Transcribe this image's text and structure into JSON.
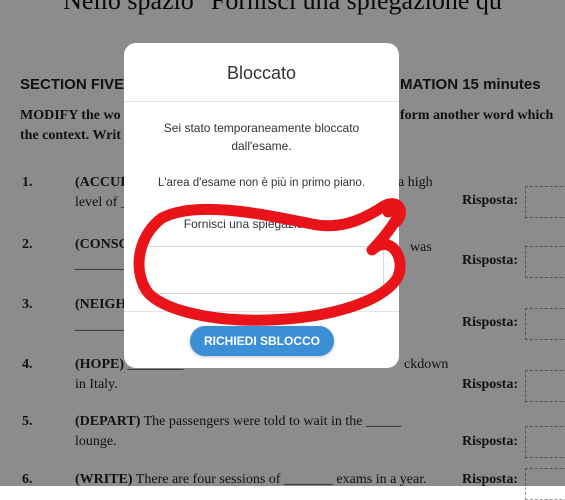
{
  "caption": "Nello spazio \"Fornisci una spiegazione qu",
  "exam": {
    "section_title_left": "SECTION FIVE C",
    "section_title_right": "MATION 15 minutes",
    "instructions_line1_left": "MODIFY the wo",
    "instructions_line1_right": "form another word which",
    "instructions_line2": "the context. Writ",
    "answer_label": "Risposta:",
    "questions": [
      {
        "num": "1.",
        "line1": "(ACCUI",
        "line2": "level of _",
        "right": "a high"
      },
      {
        "num": "2.",
        "line1": "(CONSC",
        "line2": "________",
        "right": "was"
      },
      {
        "num": "3.",
        "line1": "(NEIGH",
        "line2": "________",
        "right": ""
      },
      {
        "num": "4.",
        "line1_bold": "(HOPE)",
        "line1_rest": " ________",
        "line2": "in Italy.",
        "right": "ckdown"
      },
      {
        "num": "5.",
        "line1_bold": "(DEPART)",
        "line1_rest": " The passengers were told to wait in the _____",
        "line2": "lounge.",
        "right": ""
      },
      {
        "num": "6.",
        "line1_bold": "(WRITE)",
        "line1_rest": " There are four sessions of _______ exams in a year.",
        "line2": "",
        "right": ""
      }
    ]
  },
  "modal": {
    "title": "Bloccato",
    "message1": "Sei stato temporaneamente bloccato dall'esame.",
    "message2": "L'area d'esame non è più in primo piano.",
    "message3": "Fornisci una spiegazione qui.",
    "input_value": "",
    "button_label": "RICHIEDI SBLOCCO"
  },
  "colors": {
    "overlay": "rgba(0,0,0,0.45)",
    "button": "#3a8fd6",
    "scribble": "#e8141a"
  }
}
